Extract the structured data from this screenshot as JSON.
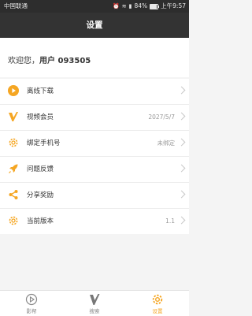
{
  "status_bar": {
    "carrier": "中国联通",
    "battery_text": "84%",
    "battery_level": 0.84,
    "time": "上午9:57"
  },
  "header": {
    "title": "设置"
  },
  "welcome": {
    "prefix": "欢迎您，",
    "user": "用户 093505"
  },
  "menu": [
    {
      "label": "离线下载",
      "value": "",
      "icon": "play-circle-icon"
    },
    {
      "label": "视频会员",
      "value": "2027/5/7",
      "icon": "v-logo-icon"
    },
    {
      "label": "绑定手机号",
      "value": "未绑定",
      "icon": "gear-icon"
    },
    {
      "label": "问题反馈",
      "value": "",
      "icon": "rocket-icon"
    },
    {
      "label": "分享奖励",
      "value": "",
      "icon": "share-icon"
    },
    {
      "label": "当前版本",
      "value": "1.1",
      "icon": "gear-icon"
    }
  ],
  "tabs": [
    {
      "label": "影帮",
      "icon": "play-circle-icon",
      "active": false
    },
    {
      "label": "搜索",
      "icon": "v-logo-icon",
      "active": false
    },
    {
      "label": "设置",
      "icon": "gear-icon",
      "active": true
    }
  ],
  "colors": {
    "accent": "#f5a623",
    "header_bg": "#333333",
    "status_bg": "#2d2d2d"
  }
}
